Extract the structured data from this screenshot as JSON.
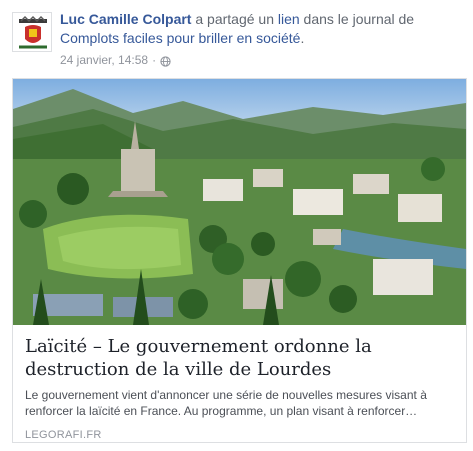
{
  "post": {
    "author": "Luc Camille Colpart",
    "action_text": " a partagé un ",
    "link_word": "lien",
    "context_text": " dans le journal de ",
    "group_name": "Complots faciles pour briller en société",
    "trailing": ".",
    "timestamp": "24 janvier, 14:58",
    "separator": "·",
    "privacy_icon": "globe-icon"
  },
  "link_card": {
    "title": "Laïcité – Le gouvernement ordonne la destruction de la ville de Lourdes",
    "description": "Le gouvernement vient d'annoncer une série de nouvelles mesures visant à renforcer la laïcité en France. Au programme, un plan visant à renforcer…",
    "domain": "LEGORAFI.FR",
    "image_subject": "aerial-view-lourdes"
  },
  "colors": {
    "link_blue": "#365899",
    "meta_gray": "#90949c",
    "border": "#dddfe2"
  }
}
